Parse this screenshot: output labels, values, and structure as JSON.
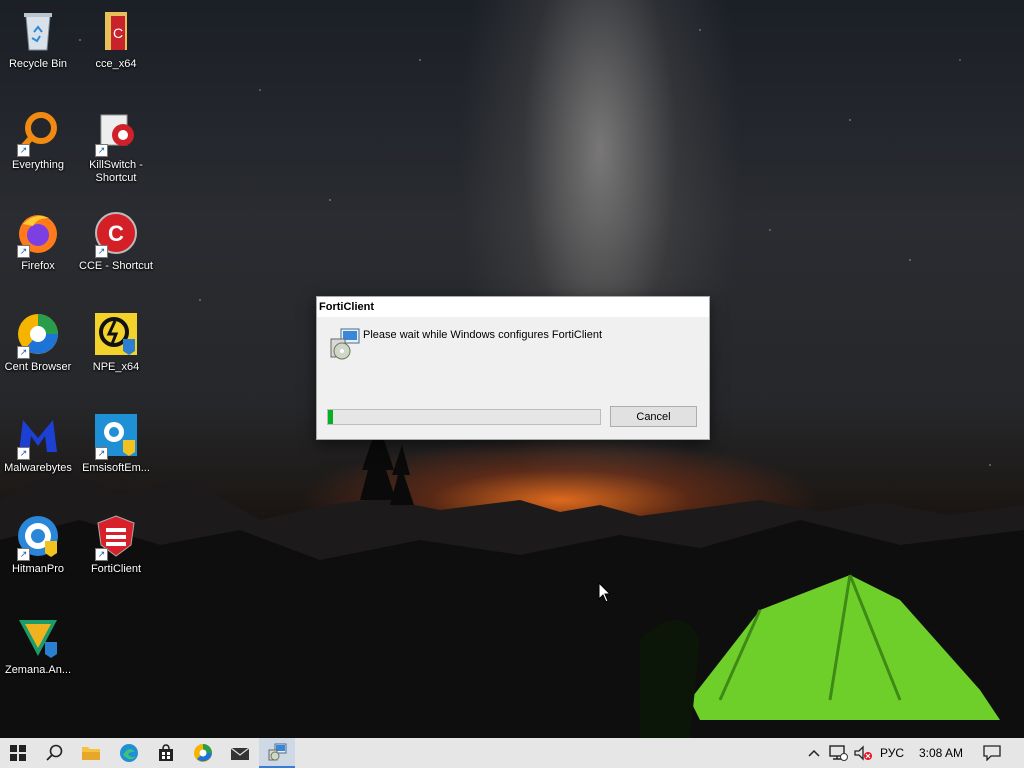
{
  "desktop": {
    "icons": [
      {
        "label": "Recycle Bin",
        "icon": "recycle-bin-icon"
      },
      {
        "label": "cce_x64",
        "icon": "folder-icon"
      },
      {
        "label": "Everything",
        "icon": "everything-search-icon"
      },
      {
        "label": "KillSwitch - Shortcut",
        "icon": "killswitch-icon"
      },
      {
        "label": "Firefox",
        "icon": "firefox-icon"
      },
      {
        "label": "CCE - Shortcut",
        "icon": "cce-icon"
      },
      {
        "label": "Cent Browser",
        "icon": "cent-browser-icon"
      },
      {
        "label": "NPE_x64",
        "icon": "npe-icon"
      },
      {
        "label": "Malwarebytes",
        "icon": "malwarebytes-icon"
      },
      {
        "label": "EmsisoftEm...",
        "icon": "emsisoft-icon"
      },
      {
        "label": "HitmanPro",
        "icon": "hitmanpro-icon"
      },
      {
        "label": "FortiClient",
        "icon": "forticlient-icon"
      },
      {
        "label": "Zemana.An...",
        "icon": "zemana-icon"
      }
    ]
  },
  "dialog": {
    "title": "FortiClient",
    "message": "Please wait while Windows configures FortiClient",
    "progress_percent": 2,
    "cancel_label": "Cancel",
    "progress_color": "#06b025"
  },
  "taskbar": {
    "pinned": [
      "start-icon",
      "search-icon",
      "file-explorer-icon",
      "edge-icon",
      "store-icon",
      "cent-browser-icon",
      "mail-icon",
      "installer-icon"
    ],
    "active": "installer-icon",
    "tray": {
      "language": "РУС",
      "time": "3:08 AM"
    }
  }
}
